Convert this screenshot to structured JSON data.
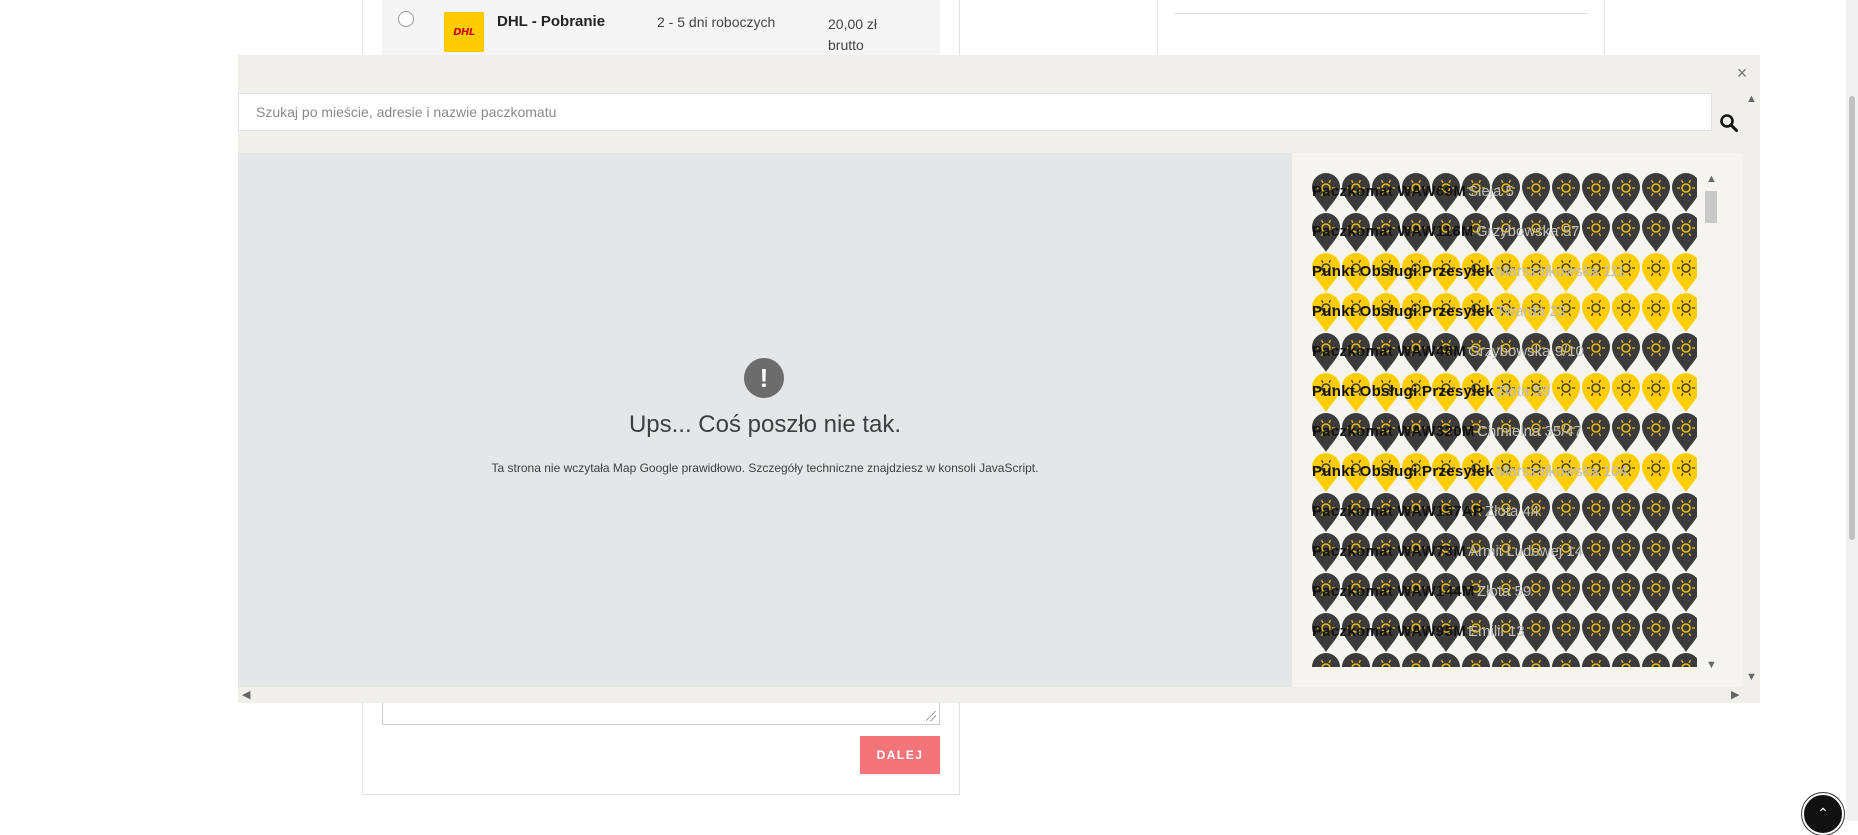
{
  "shipping": {
    "name": "DHL - Pobranie",
    "logo_text": "DHL",
    "delivery_time": "2 - 5 dni roboczych",
    "price": "20,00 zł brutto"
  },
  "next_button": "DALEJ",
  "modal": {
    "close_symbol": "×",
    "search": {
      "placeholder": "Szukaj po mieście, adresie i nazwie paczkomatu",
      "value": ""
    },
    "map_error": {
      "icon": "!",
      "title": "Ups... Coś poszło nie tak.",
      "text": "Ta strona nie wczytała Map Google prawidłowo. Szczegóły techniczne znajdziesz w konsoli JavaScript."
    },
    "locations": [
      {
        "name": "Paczkomat WAW69M",
        "address": "Sieja 5",
        "pin": "dark"
      },
      {
        "name": "Paczkomat WAW116M",
        "address": "Grzybowska 57",
        "pin": "dark"
      },
      {
        "name": "Punkt Obsługi Przesyłek",
        "address": "Marszałkowska 111",
        "pin": "yellow"
      },
      {
        "name": "Punkt Obsługi Przesyłek",
        "address": "Twarda 22",
        "pin": "yellow"
      },
      {
        "name": "Paczkomat WAW48M",
        "address": "Grzybowska 9/10",
        "pin": "dark"
      },
      {
        "name": "Punkt Obsługi Przesyłek",
        "address": "Złota 59",
        "pin": "yellow"
      },
      {
        "name": "Paczkomat WAW320M",
        "address": "Chmielna 35/47",
        "pin": "dark"
      },
      {
        "name": "Punkt Obsługi Przesyłek",
        "address": "Marszałkowska 104",
        "pin": "yellow"
      },
      {
        "name": "Paczkomat WAW157AP",
        "address": "Złota 44",
        "pin": "dark"
      },
      {
        "name": "Paczkomat WAW73M",
        "address": "Armii Ludowej 14",
        "pin": "dark"
      },
      {
        "name": "Paczkomat WAW144M",
        "address": "Złota 59",
        "pin": "dark"
      },
      {
        "name": "Paczkomat WAW95M",
        "address": "Emilii 13",
        "pin": "dark"
      },
      {
        "name": "",
        "address": "",
        "pin": "dark"
      }
    ]
  },
  "colors": {
    "accent_button": "#f37479",
    "pin_dark": "#3b3b3b",
    "pin_yellow": "#ffcd00",
    "map_bg": "#e5e6e8",
    "list_bg": "#f6f4ee"
  },
  "icons": {
    "close": "close-icon",
    "search": "search-icon",
    "scroll_top": "chevron-up-icon"
  }
}
